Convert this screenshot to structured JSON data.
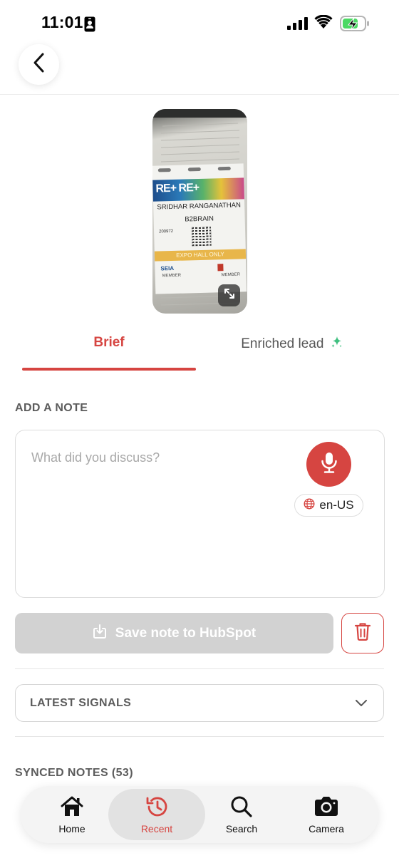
{
  "status_bar": {
    "time": "11:01"
  },
  "colors": {
    "accent": "#d64541",
    "disabled": "#d2d2d2",
    "sparkle": "#3fbf7f"
  },
  "badge_photo": {
    "name": "SRIDHAR RANGANATHAN",
    "company": "B2BRAIN",
    "number": "200972",
    "logo": "RE+ RE+",
    "banner": "EXPO HALL ONLY",
    "seia": "SEIA",
    "member_left": "MEMBER",
    "member_right": "MEMBER"
  },
  "tabs": [
    {
      "label": "Brief",
      "active": true
    },
    {
      "label": "Enriched lead",
      "icon": "sparkle-icon",
      "active": false
    }
  ],
  "add_note": {
    "section_title": "ADD A NOTE",
    "placeholder": "What did you discuss?",
    "language": "en-US"
  },
  "actions": {
    "save_label": "Save note to HubSpot",
    "save_enabled": false
  },
  "signals": {
    "title": "LATEST SIGNALS"
  },
  "synced_notes": {
    "title": "SYNCED NOTES (53)"
  },
  "bottom_nav": [
    {
      "label": "Home",
      "icon": "home-icon",
      "active": false
    },
    {
      "label": "Recent",
      "icon": "history-icon",
      "active": true
    },
    {
      "label": "Search",
      "icon": "search-icon",
      "active": false
    },
    {
      "label": "Camera",
      "icon": "camera-icon",
      "active": false
    }
  ]
}
